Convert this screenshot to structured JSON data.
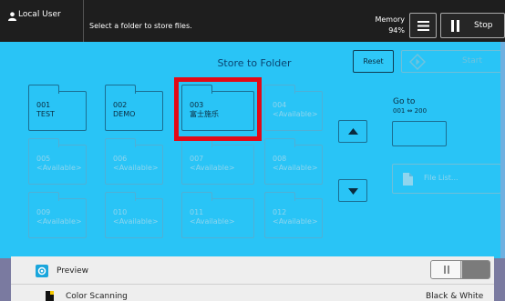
{
  "header": {
    "user_label": "Local User",
    "instruction": "Select a folder to store files.",
    "memory_label": "Memory",
    "memory_value": "94%",
    "stop_label": "Stop"
  },
  "main": {
    "title": "Store to Folder",
    "reset_label": "Reset",
    "start_label": "Start",
    "goto_label": "Go to",
    "goto_range": "001 ⇔ 200",
    "file_list_label": "File List..."
  },
  "folders": [
    {
      "number": "001",
      "name": "TEST",
      "available": false
    },
    {
      "number": "002",
      "name": "DEMO",
      "available": false
    },
    {
      "number": "003",
      "name": "富士施乐",
      "available": false,
      "selected": true
    },
    {
      "number": "004",
      "name": "<Available>",
      "available": true
    },
    {
      "number": "005",
      "name": "<Available>",
      "available": true
    },
    {
      "number": "006",
      "name": "<Available>",
      "available": true
    },
    {
      "number": "007",
      "name": "<Available>",
      "available": true
    },
    {
      "number": "008",
      "name": "<Available>",
      "available": true
    },
    {
      "number": "009",
      "name": "<Available>",
      "available": true
    },
    {
      "number": "010",
      "name": "<Available>",
      "available": true
    },
    {
      "number": "011",
      "name": "<Available>",
      "available": true
    },
    {
      "number": "012",
      "name": "<Available>",
      "available": true
    }
  ],
  "bottom": {
    "preview_label": "Preview",
    "color_label": "Color Scanning",
    "color_value": "Black & White"
  },
  "colors": {
    "background": "#29c4f6",
    "selection_border": "#e20a17",
    "topbar": "#1e1e1e"
  }
}
